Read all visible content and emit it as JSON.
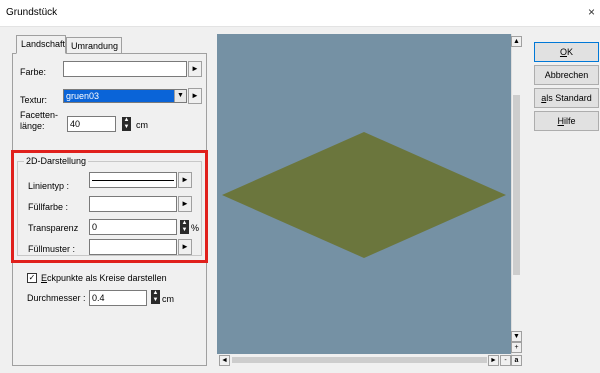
{
  "window": {
    "title": "Grundstück",
    "close": "×"
  },
  "tabs": [
    {
      "label": "Landschaft"
    },
    {
      "label": "Umrandung"
    }
  ],
  "landschaft": {
    "farbe_label": "Farbe:",
    "farbe_value": "",
    "textur_label": "Textur:",
    "textur_value": "gruen03",
    "facetten_label_1": "Facetten-",
    "facetten_label_2": "länge:",
    "facetten_value": "40",
    "facetten_unit": "cm"
  },
  "darstellung_2d": {
    "legend": "2D-Darstellung",
    "linientyp_label": "Linientyp :",
    "fuellfarbe_label": "Füllfarbe :",
    "transparenz_label": "Transparenz",
    "transparenz_value": "0",
    "transparenz_unit": "%",
    "fuellmuster_label": "Füllmuster :"
  },
  "eckpunkte": {
    "checkbox_checked": true,
    "checkbox_label_first": "E",
    "checkbox_label_rest": "ckpunkte als Kreise darstellen",
    "durchmesser_label": "Durchmesser :",
    "durchmesser_value": "0.4",
    "durchmesser_unit": "cm"
  },
  "preview": {
    "background_color": "#7591a4",
    "plane_color": "#6b763d"
  },
  "buttons": {
    "ok_first": "O",
    "ok_rest": "K",
    "abbrechen": "Abbrechen",
    "standard_first": "a",
    "standard_rest": "ls Standard",
    "hilfe_first": "H",
    "hilfe_rest": "ilfe"
  },
  "scrollbar": {
    "up": "▲",
    "down": "▼",
    "left": "◄",
    "right": "►",
    "plus": "+",
    "minus": "-",
    "a": "a"
  },
  "glyphs": {
    "arrow_right": "►",
    "dropdown": "▼",
    "spin_up": "▲",
    "spin_down": "▼",
    "check": "✓"
  }
}
